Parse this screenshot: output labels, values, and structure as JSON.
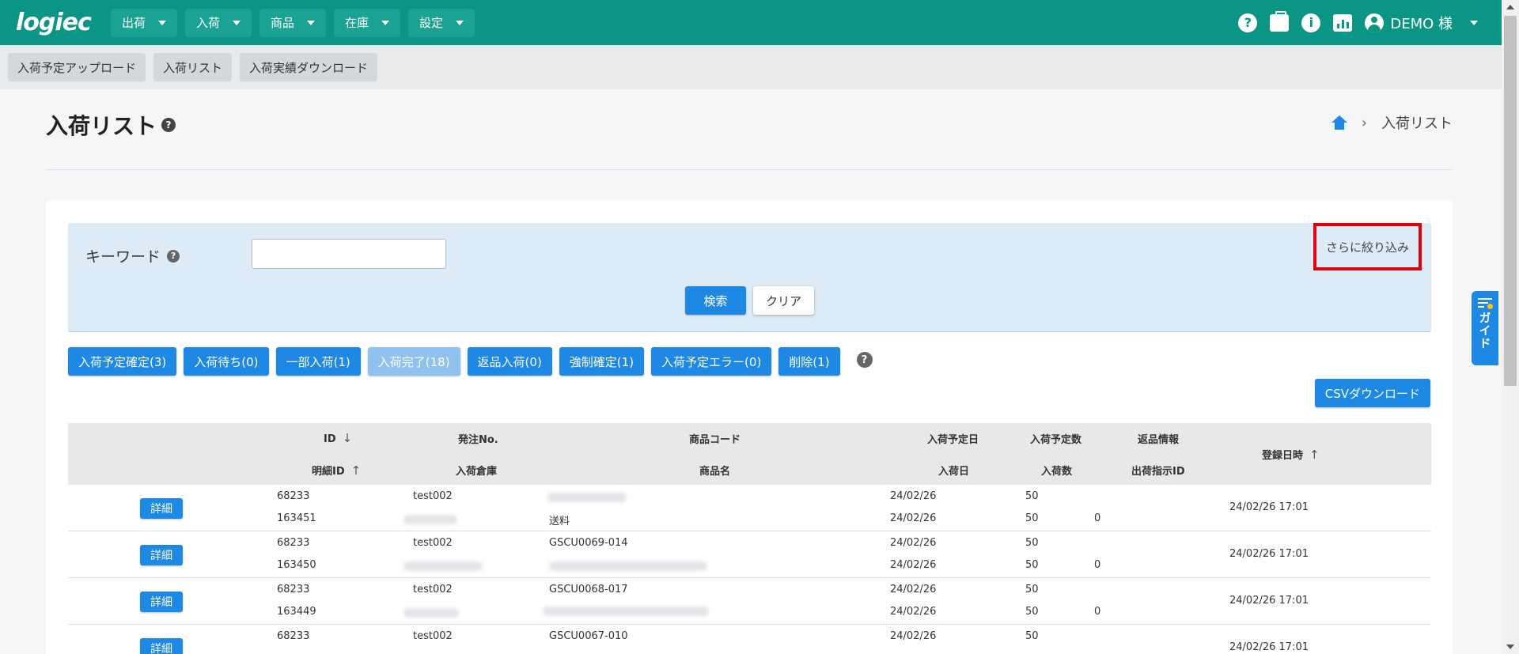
{
  "app": {
    "logo": "logiec"
  },
  "nav": {
    "menus": [
      "出荷",
      "入荷",
      "商品",
      "在庫",
      "設定"
    ],
    "icons": [
      "help-icon",
      "briefcase-icon",
      "info-icon",
      "chart-icon",
      "user-icon"
    ],
    "help_glyph": "?",
    "info_glyph": "i",
    "user": "DEMO 様"
  },
  "subnav": [
    "入荷予定アップロード",
    "入荷リスト",
    "入荷実績ダウンロード"
  ],
  "page": {
    "title": "入荷リスト",
    "help_glyph": "?",
    "breadcrumb_sep": "›",
    "breadcrumb_current": "入荷リスト"
  },
  "search": {
    "keyword_label": "キーワード",
    "help_glyph": "?",
    "keyword_value": "",
    "filter_more": "さらに絞り込み",
    "search_btn": "検索",
    "clear_btn": "クリア"
  },
  "status_buttons": [
    {
      "label": "入荷予定確定(3)",
      "disabled": false
    },
    {
      "label": "入荷待ち(0)",
      "disabled": false
    },
    {
      "label": "一部入荷(1)",
      "disabled": false
    },
    {
      "label": "入荷完了(18)",
      "disabled": true
    },
    {
      "label": "返品入荷(0)",
      "disabled": false
    },
    {
      "label": "強制確定(1)",
      "disabled": false
    },
    {
      "label": "入荷予定エラー(0)",
      "disabled": false
    },
    {
      "label": "削除(1)",
      "disabled": false
    }
  ],
  "status_help_glyph": "?",
  "csv_btn": "CSVダウンロード",
  "table": {
    "headers": {
      "id": "ID",
      "detail_id": "明細ID",
      "order_no": "発注No.",
      "warehouse": "入荷倉庫",
      "product_code": "商品コード",
      "product_name": "商品名",
      "planned_date": "入荷予定日",
      "arrival_date": "入荷日",
      "planned_qty": "入荷予定数",
      "arrival_qty": "入荷数",
      "return_info": "返品情報",
      "ship_id": "出荷指示ID",
      "registered": "登録日時"
    },
    "sort": {
      "id_arrow": "↓",
      "detail_arrow": "↑",
      "registered_arrow": "↑"
    },
    "detail_label": "詳細",
    "rows": [
      {
        "id": "68233",
        "detail_id": "163451",
        "order_no": "test002",
        "product_code": "",
        "product_name": "送料",
        "planned_date": "24/02/26",
        "arrival_date": "24/02/26",
        "planned_qty": "50",
        "arrival_qty": "50",
        "return_qty": "0",
        "registered": "24/02/26 17:01"
      },
      {
        "id": "68233",
        "detail_id": "163450",
        "order_no": "test002",
        "product_code": "GSCU0069-014",
        "product_name": "",
        "planned_date": "24/02/26",
        "arrival_date": "24/02/26",
        "planned_qty": "50",
        "arrival_qty": "50",
        "return_qty": "0",
        "registered": "24/02/26 17:01"
      },
      {
        "id": "68233",
        "detail_id": "163449",
        "order_no": "test002",
        "product_code": "GSCU0068-017",
        "product_name": "",
        "planned_date": "24/02/26",
        "arrival_date": "24/02/26",
        "planned_qty": "50",
        "arrival_qty": "50",
        "return_qty": "0",
        "registered": "24/02/26 17:01"
      },
      {
        "id": "68233",
        "detail_id": "",
        "order_no": "test002",
        "product_code": "GSCU0067-010",
        "product_name": "",
        "planned_date": "24/02/26",
        "arrival_date": "",
        "planned_qty": "50",
        "arrival_qty": "",
        "return_qty": "",
        "registered": "24/02/26 17:01"
      }
    ]
  },
  "guide": {
    "label": "ガイド"
  }
}
